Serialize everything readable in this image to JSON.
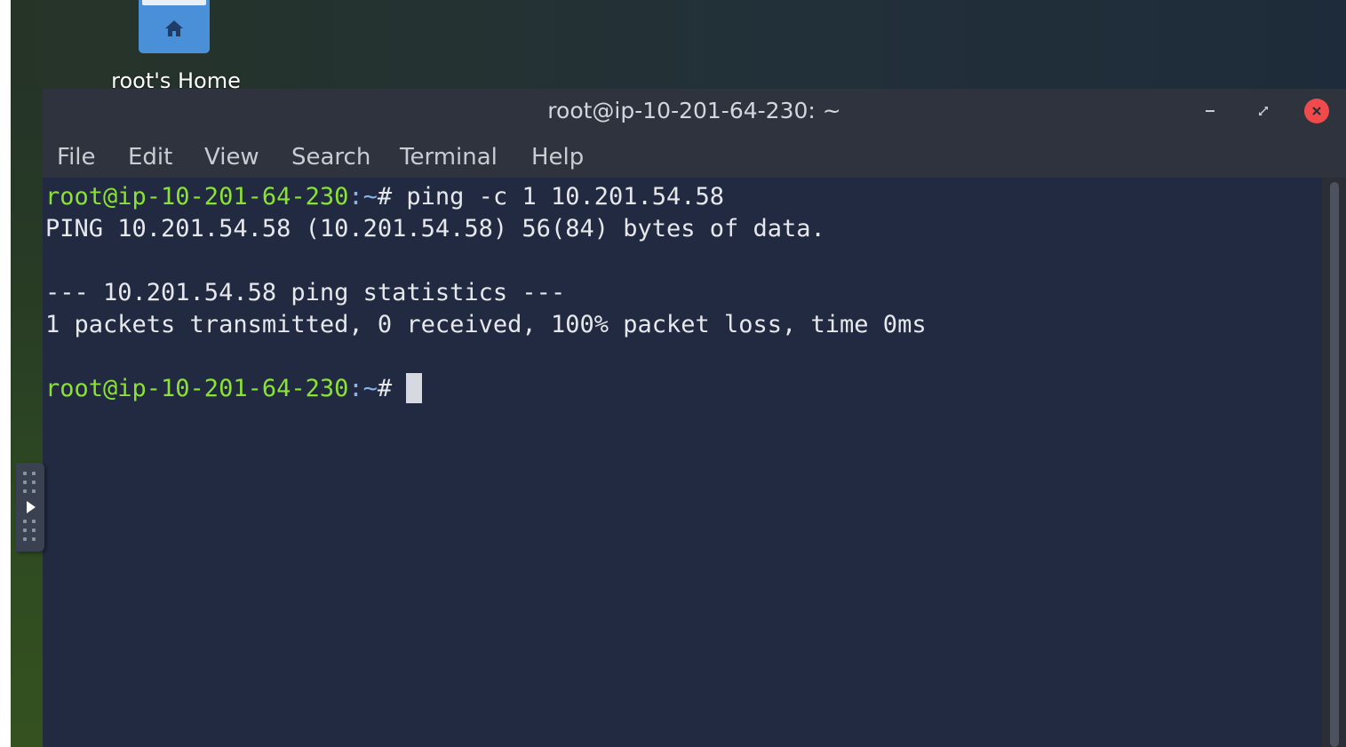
{
  "desktop": {
    "home_icon": {
      "icon": "home-folder-icon",
      "label": "root's Home"
    }
  },
  "window": {
    "title": "root@ip-10-201-64-230: ~",
    "controls": {
      "minimize": "minimize-icon",
      "maximize": "maximize-icon",
      "close": "close-icon"
    },
    "colors": {
      "close_button": "#f04a4a",
      "terminal_bg": "#212a40",
      "prompt_user": "#8ae234",
      "prompt_dir": "#8ab4e8"
    }
  },
  "menubar": {
    "items": [
      "File",
      "Edit",
      "View",
      "Search",
      "Terminal",
      "Help"
    ]
  },
  "terminal": {
    "prompt_user": "root@ip-10-201-64-230",
    "prompt_dir": ":~",
    "prompt_sym": "# ",
    "lines": [
      "ping -c 1 10.201.54.58",
      "PING 10.201.54.58 (10.201.54.58) 56(84) bytes of data.",
      "",
      "--- 10.201.54.58 ping statistics ---",
      "1 packets transmitted, 0 received, 100% packet loss, time 0ms",
      ""
    ]
  },
  "side_panel": {
    "icon": "play-arrow-icon"
  }
}
